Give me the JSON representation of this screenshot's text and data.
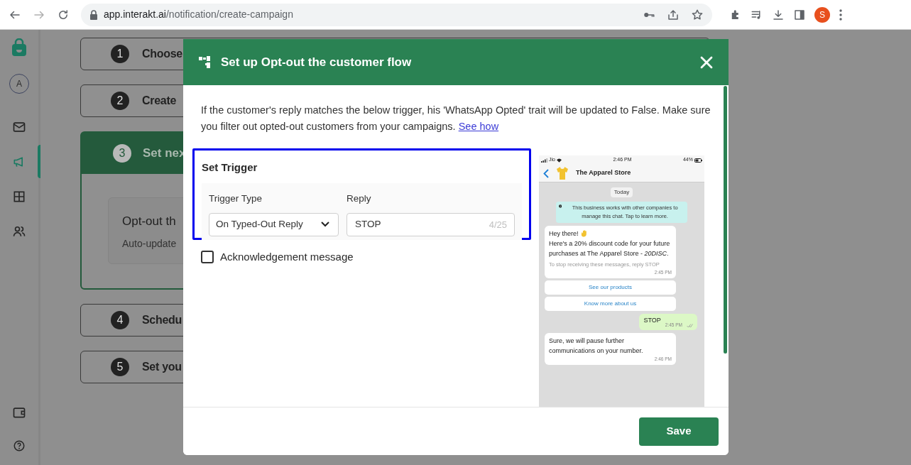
{
  "browser": {
    "url_host": "app.interakt.ai",
    "url_path": "/notification/create-campaign",
    "profile_initial": "S"
  },
  "sidebar": {
    "avatar_initial": "A",
    "nav_items": [
      {
        "selected": false
      },
      {
        "selected": true
      },
      {
        "selected": false
      },
      {
        "selected": false
      }
    ]
  },
  "steps": [
    {
      "number": "1",
      "title": "Choose",
      "expanded": false
    },
    {
      "number": "2",
      "title": "Create",
      "expanded": false
    },
    {
      "number": "3",
      "title": "Set nex",
      "expanded": true,
      "card_title": "Opt-out th",
      "card_subtitle": "Auto-update"
    },
    {
      "number": "4",
      "title": "Schedu",
      "expanded": false
    },
    {
      "number": "5",
      "title": "Set you",
      "expanded": false
    }
  ],
  "modal": {
    "title": "Set up Opt-out the customer flow",
    "description": "If the customer's reply matches the below trigger, his 'WhatsApp Opted' trait will be updated to False. Make sure you filter out opted-out customers from your campaigns.",
    "description_link": "See how",
    "trigger": {
      "title": "Set Trigger",
      "highlighted": true,
      "trigger_type_label": "Trigger Type",
      "trigger_type_value": "On Typed-Out Reply",
      "reply_label": "Reply",
      "reply_value": "STOP",
      "reply_counter": "4/25"
    },
    "acknowledgement": {
      "label": "Acknowledgement message",
      "checked": false
    },
    "preview": {
      "carrier": "Jio",
      "time": "2:46 PM",
      "battery": "44%",
      "contact": "The Apparel Store",
      "date": "Today",
      "notice": "This business works with other companies to manage this chat. Tap to learn more.",
      "messages": [
        {
          "kind": "incoming",
          "greeting": "Hey there!",
          "text": "Here's a 20% discount code for your future purchases at The Apparel Store - *20DISC*.",
          "footer": "To stop receiving these messages, reply STOP",
          "time": "2:45 PM",
          "buttons": [
            "See our products",
            "Know more about us"
          ]
        },
        {
          "kind": "outgoing",
          "text": "STOP",
          "time": "2:45 PM"
        },
        {
          "kind": "incoming",
          "text": "Sure, we will pause further communications on your number.",
          "time": "2:46 PM"
        }
      ]
    },
    "save_button": "Save"
  }
}
